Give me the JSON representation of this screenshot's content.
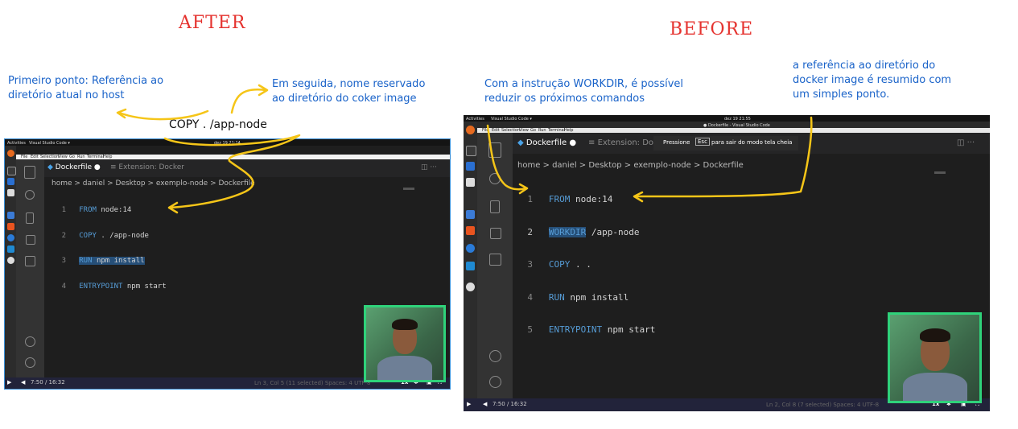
{
  "titles": {
    "after": "AFTER",
    "before": "BEFORE"
  },
  "annotations": {
    "after_left": [
      "Primeiro ponto: Referência ao",
      "diretório atual no host"
    ],
    "after_right": [
      "Em seguida, nome reservado",
      "ao diretório do coker image"
    ],
    "after_command": "COPY  .  /app-node",
    "before_left": [
      "Com a instrução WORKDIR, é possível",
      "reduzir os próximos comandos"
    ],
    "before_right": [
      "a referência ao diretório do",
      "docker image é resumido com",
      "um simples ponto."
    ]
  },
  "after_shot": {
    "topbar": {
      "activities": "Activities",
      "app": "Visual Studio Code ▾",
      "clock": "dez 19 21:14"
    },
    "menu": [
      "File",
      "Edit",
      "Selection",
      "View",
      "Go",
      "Run",
      "Terminal",
      "Help"
    ],
    "tabs": {
      "active": "Dockerfile",
      "inactive": "Extension: Docker"
    },
    "breadcrumb": "home > daniel > Desktop > exemplo-node > Dockerfile",
    "lines": [
      {
        "n": "1",
        "kw": "FROM",
        "rest": " node:14"
      },
      {
        "n": "2",
        "kw": "COPY",
        "rest": " . /app-node"
      },
      {
        "n": "3",
        "kw": "RUN",
        "rest": " npm install"
      },
      {
        "n": "4",
        "kw": "ENTRYPOINT",
        "rest": " npm start"
      }
    ],
    "status": "Ln 3, Col 5 (11 selected)   Spaces: 4   UTF-8",
    "player": {
      "time": "7:50 / 16:32",
      "speed": "1x"
    }
  },
  "before_shot": {
    "topbar": {
      "activities": "Activities",
      "app": "Visual Studio Code ▾",
      "clock": "dez 19 21:55",
      "window": "● Dockerfile - Visual Studio Code"
    },
    "menu": [
      "File",
      "Edit",
      "Selection",
      "View",
      "Go",
      "Run",
      "Terminal",
      "Help"
    ],
    "toast": {
      "before": "Pressione",
      "key": "Esc",
      "after": "para sair do modo tela cheia"
    },
    "tabs": {
      "active": "Dockerfile",
      "inactive": "Extension: Docker"
    },
    "breadcrumb": "home > daniel > Desktop > exemplo-node > Dockerfile",
    "lines": [
      {
        "n": "1",
        "kw": "FROM",
        "rest": " node:14"
      },
      {
        "n": "2",
        "kw": "WORKDIR",
        "rest": " /app-node"
      },
      {
        "n": "3",
        "kw": "COPY",
        "rest": " . ."
      },
      {
        "n": "4",
        "kw": "RUN",
        "rest": " npm install"
      },
      {
        "n": "5",
        "kw": "ENTRYPOINT",
        "rest": " npm start"
      }
    ],
    "status": "Ln 2, Col 8 (7 selected)   Spaces: 4   UTF-8",
    "player": {
      "time": "7:50 / 16:32",
      "speed": "1x"
    }
  },
  "colors": {
    "arrow": "#f5c518",
    "title": "#e5332f",
    "note": "#1a63c9",
    "webcam_border": "#2fd27a"
  }
}
